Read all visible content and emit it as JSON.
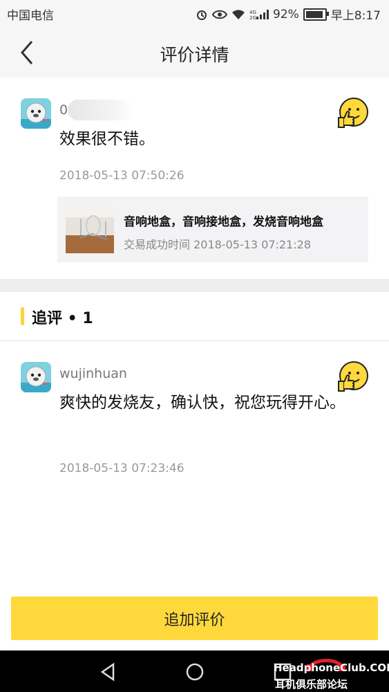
{
  "status_bar": {
    "carrier": "中国电信",
    "battery": "92%",
    "battery_level": 0.92,
    "time": "早上8:17",
    "icons": [
      "alarm-icon",
      "eye-icon",
      "wifi-icon",
      "signal-icon",
      "battery-icon"
    ]
  },
  "nav": {
    "title": "评价详情",
    "back_icon": "chevron-left-icon"
  },
  "review": {
    "username": "0",
    "content": "效果很不错。",
    "date": "2018-05-13 07:50:26",
    "rating_icon": "thumbs-up-smiley-icon"
  },
  "product": {
    "name": "音响地盒，音响接地盒，发烧音响地盒",
    "time": "交易成功时间 2018-05-13 07:21:28"
  },
  "followup": {
    "section_title": "追评 • 1",
    "username": "wujinhuan",
    "content": "爽快的发烧友，确认快，祝您玩得开心。",
    "date": "2018-05-13 07:23:46",
    "rating_icon": "thumbs-up-smiley-icon"
  },
  "actions": {
    "add_review": "追加评价"
  },
  "colors": {
    "accent": "#ffd93b",
    "section_bar": "#ffd33b",
    "page_bg": "#ffffff",
    "band": "#eeeef1"
  },
  "watermark": {
    "brand": "HeadphoneClub.COM",
    "cn": "耳机俱乐部论坛"
  }
}
